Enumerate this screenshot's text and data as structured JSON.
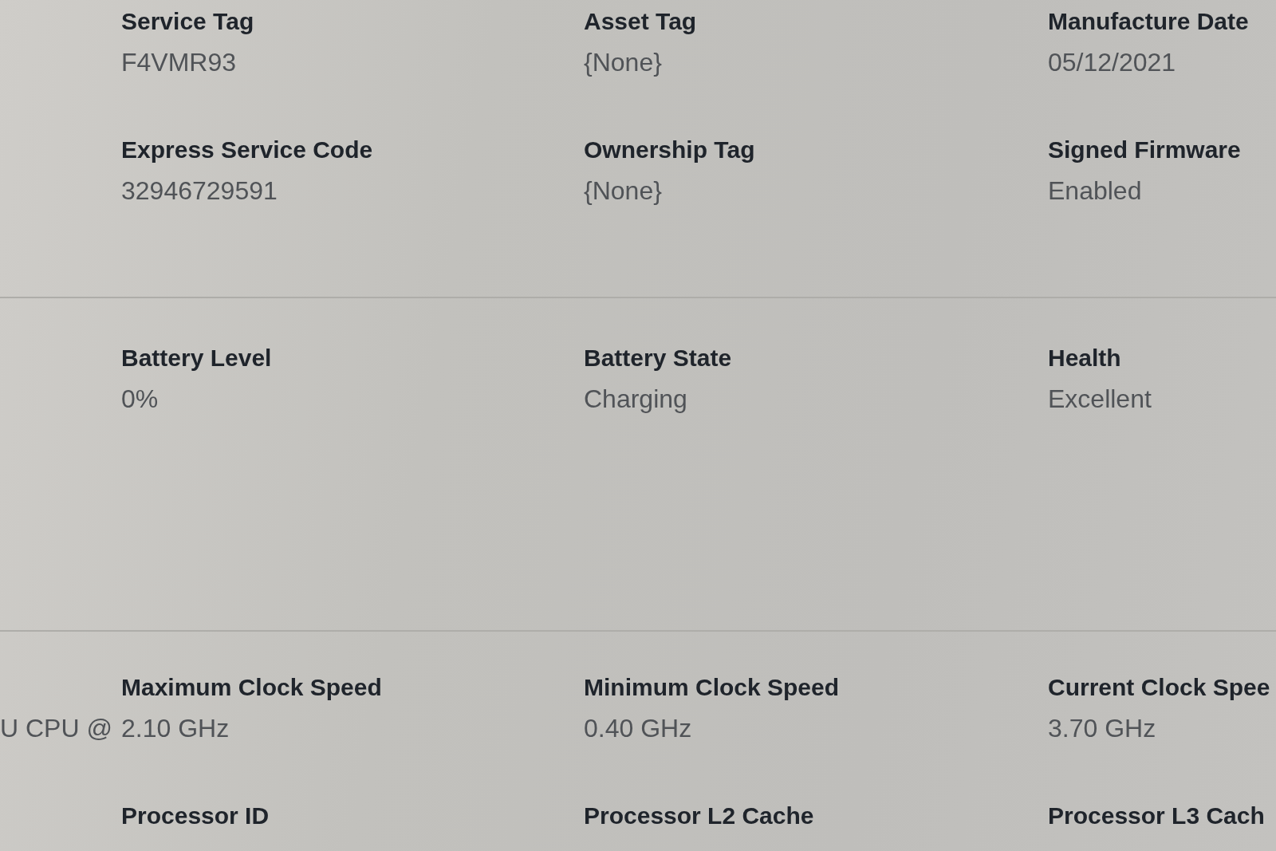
{
  "sections": [
    {
      "fields": [
        {
          "label": "Service Tag",
          "value": "F4VMR93"
        },
        {
          "label": "Asset Tag",
          "value": "{None}"
        },
        {
          "label": "Manufacture Date",
          "value": "05/12/2021"
        },
        {
          "label": "Express Service Code",
          "value": "32946729591"
        },
        {
          "label": "Ownership Tag",
          "value": "{None}"
        },
        {
          "label": "Signed Firmware",
          "value": "Enabled"
        }
      ]
    },
    {
      "fields": [
        {
          "label": "Battery Level",
          "value": "0%"
        },
        {
          "label": "Battery State",
          "value": "Charging"
        },
        {
          "label": "Health",
          "value": "Excellent"
        }
      ]
    },
    {
      "column_1_value": "U CPU @",
      "fields": [
        {
          "label": "Maximum Clock Speed",
          "value": "2.10 GHz"
        },
        {
          "label": "Minimum Clock Speed",
          "value": "0.40 GHz"
        },
        {
          "label": "Current Clock Spee",
          "value": "3.70 GHz"
        },
        {
          "label": "Processor ID"
        },
        {
          "label": "Processor L2 Cache"
        },
        {
          "label": "Processor L3 Cach"
        }
      ]
    }
  ]
}
